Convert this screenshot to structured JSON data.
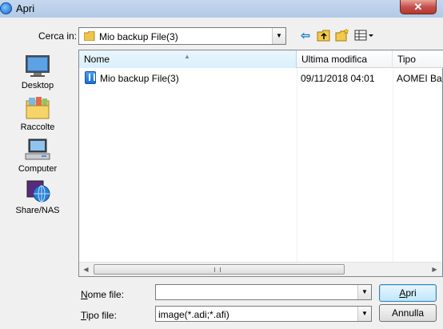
{
  "window": {
    "title": "Apri"
  },
  "lookin": {
    "label": "Cerca in:",
    "value": "Mio backup File(3)"
  },
  "toolbar": {
    "icons": [
      "back-icon",
      "up-folder-icon",
      "new-folder-icon",
      "view-menu-icon"
    ]
  },
  "places": [
    {
      "label": "Desktop",
      "icon": "desktop-icon"
    },
    {
      "label": "Raccolte",
      "icon": "libraries-icon"
    },
    {
      "label": "Computer",
      "icon": "computer-icon"
    },
    {
      "label": "Share/NAS",
      "icon": "network-globe-icon"
    }
  ],
  "columns": {
    "name": "Nome",
    "date": "Ultima modifica",
    "type": "Tipo"
  },
  "files": [
    {
      "name": "Mio backup File(3)",
      "date": "09/11/2018 04:01",
      "type": "AOMEI Ba"
    }
  ],
  "filename": {
    "label_u": "N",
    "label_rest": "ome file:",
    "value": ""
  },
  "filetype": {
    "label_u": "T",
    "label_rest": "ipo file:",
    "value": "image(*.adi;*.afi)"
  },
  "buttons": {
    "open_u": "A",
    "open_rest": "pri",
    "cancel": "Annulla"
  }
}
